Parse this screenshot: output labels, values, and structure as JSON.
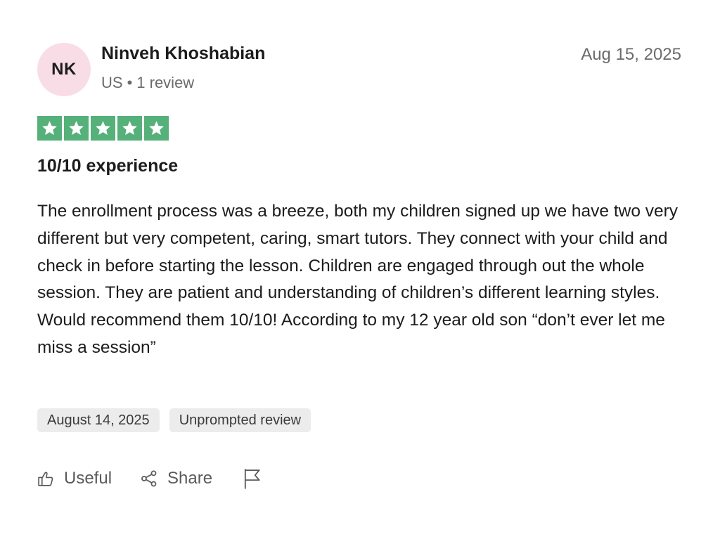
{
  "author": {
    "initials": "NK",
    "name": "Ninveh Khoshabian",
    "country": "US",
    "separator": "•",
    "review_count": "1 review"
  },
  "review": {
    "date": "Aug 15, 2025",
    "rating": 5,
    "rating_max": 5,
    "title": "10/10 experience",
    "body": "The enrollment process was a breeze, both my children signed up we have two very different but very competent, caring, smart tutors. They connect with your child and check in before starting the lesson. Children are engaged through out the whole session. They are patient and understanding of children’s different learning styles. Would recommend them 10/10! According to my 12 year old son “don’t ever let me miss a session”",
    "tags": {
      "experience_date": "August 14, 2025",
      "review_type": "Unprompted review"
    }
  },
  "actions": {
    "useful_label": "Useful",
    "share_label": "Share",
    "flag_icon": "flag-icon"
  },
  "colors": {
    "avatar_bg": "#f8dde6",
    "star_green": "#56b07a",
    "tag_bg": "#ececec",
    "muted_text": "#6b6b6b"
  }
}
